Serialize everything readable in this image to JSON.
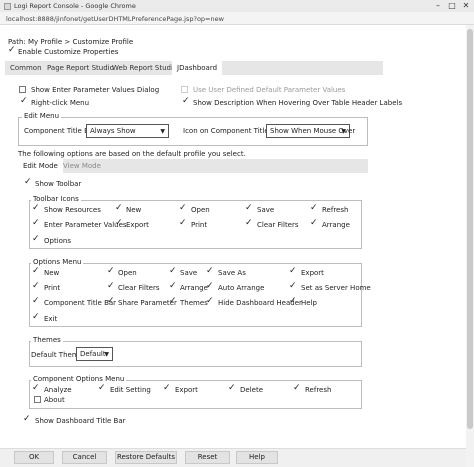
{
  "window": {
    "title": "Logi Report Console - Google Chrome",
    "url": "localhost:8888/jinfonet/getUserDHTMLPreferencePage.jsp?op=new"
  },
  "path": "Path: My Profile > Customize Profile",
  "enable_customize": "Enable Customize Properties",
  "tabs": [
    "Common",
    "Page Report Studio",
    "Web Report Studio",
    "JDashboard"
  ],
  "general": {
    "show_enter_params": "Show Enter Parameter Values Dialog",
    "use_user_defined": "Use User Defined Default Parameter Values",
    "right_click": "Right-click Menu",
    "show_description": "Show Description When Hovering Over Table Header Labels"
  },
  "edit_menu": {
    "legend": "Edit Menu",
    "component_title_bar_label": "Component Title Bar",
    "component_title_bar_value": "Always Show",
    "icon_title_bar_label": "Icon on Component Title Bar",
    "icon_title_bar_value": "Show When Mouse Over"
  },
  "profile_note": "The following options are based on the default profile you select.",
  "mode_tabs": [
    "Edit Mode",
    "View Mode"
  ],
  "show_toolbar": "Show Toolbar",
  "toolbar_icons": {
    "legend": "Toolbar Icons",
    "items": [
      "Show Resources",
      "New",
      "Open",
      "Save",
      "Refresh",
      "Enter Parameter Values",
      "Export",
      "Print",
      "Clear Filters",
      "Arrange",
      "Options"
    ]
  },
  "options_menu": {
    "legend": "Options Menu",
    "items": [
      "New",
      "Open",
      "Save",
      "Save As",
      "Export",
      "Print",
      "Clear Filters",
      "Arrange",
      "Auto Arrange",
      "Set as Server Home",
      "Component Title Bar",
      "Share Parameter",
      "Themes",
      "Hide Dashboard Header",
      "Help",
      "Exit"
    ]
  },
  "themes": {
    "legend": "Themes",
    "label": "Default Theme",
    "value": "Default"
  },
  "component_options": {
    "legend": "Component Options Menu",
    "items": [
      "Analyze",
      "Edit Setting",
      "Export",
      "Delete",
      "Refresh",
      "About"
    ]
  },
  "show_dashboard_title": "Show Dashboard Title Bar",
  "buttons": [
    "OK",
    "Cancel",
    "Restore Defaults",
    "Reset",
    "Help"
  ]
}
